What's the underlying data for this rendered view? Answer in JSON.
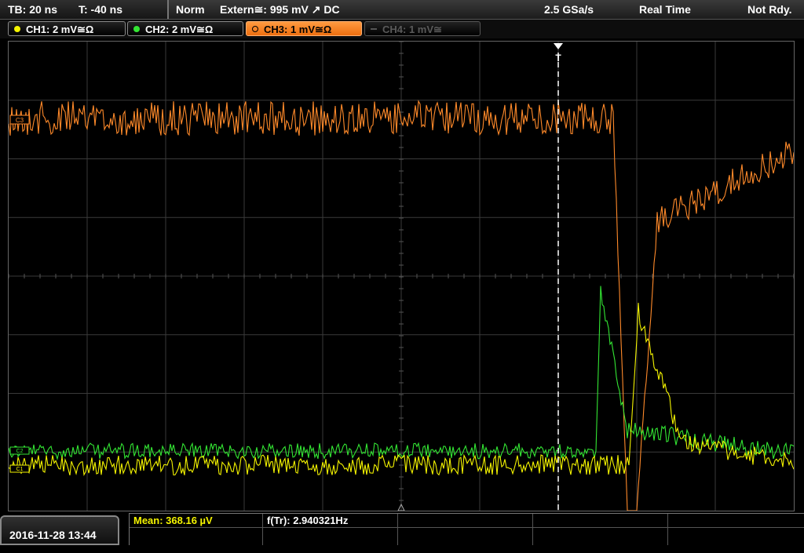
{
  "header": {
    "timebase": "TB: 20 ns",
    "trigger_time": "T: -40 ns",
    "trigger_mode": "Norm",
    "trigger_source": "Extern≅: 995 mV ↗ DC",
    "sample_rate": "2.5 GSa/s",
    "acq_mode": "Real Time",
    "status": "Not Rdy."
  },
  "channels": [
    {
      "label": "CH1: 2 mV≅Ω",
      "color": "#f4f400",
      "active": true
    },
    {
      "label": "CH2: 2 mV≅Ω",
      "color": "#33e633",
      "active": true
    },
    {
      "label": "CH3: 1 mV≅Ω",
      "color": "#ff8a2a",
      "active": true,
      "selected": true
    },
    {
      "label": "CH4: 1 mV≅",
      "color": "#777777",
      "active": false
    }
  ],
  "waveform_markers": {
    "ch3_marker": "C3",
    "ch2_marker": "C2",
    "ch1_marker": "C1",
    "trigger_marker": "T"
  },
  "measurements": {
    "mean": "Mean: 368.16 µV",
    "frequency": "f(Tr): 2.940321Hz"
  },
  "datetime": "2016-11-28 13:44",
  "colors": {
    "ch1": "#f4f400",
    "ch2": "#33e633",
    "ch3": "#ff8a2a",
    "grid": "#3a3a3a"
  }
}
